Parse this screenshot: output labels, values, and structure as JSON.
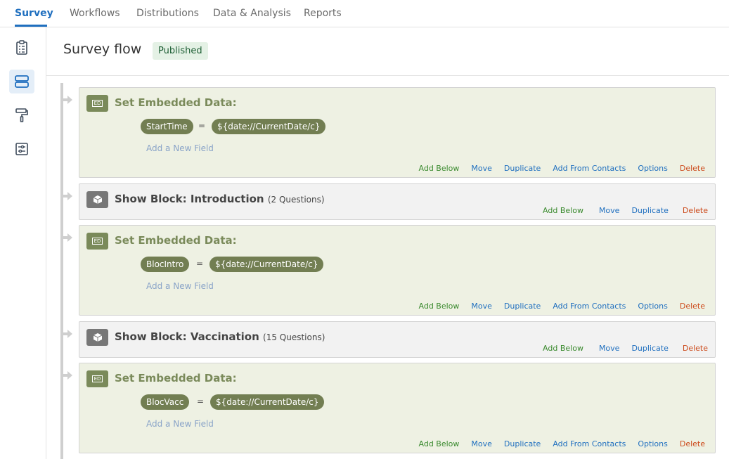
{
  "nav": {
    "tabs": [
      "Survey",
      "Workflows",
      "Distributions",
      "Data & Analysis",
      "Reports"
    ],
    "active": "Survey"
  },
  "sidebar": {
    "items": [
      {
        "icon": "clipboard-icon",
        "active": false
      },
      {
        "icon": "survey-flow-icon",
        "active": true
      },
      {
        "icon": "paint-roller-icon",
        "active": false
      },
      {
        "icon": "sliders-icon",
        "active": false
      }
    ]
  },
  "header": {
    "title": "Survey flow",
    "status": "Published"
  },
  "colors": {
    "accent": "#1f6fbf",
    "ed_bg": "#eef1e3",
    "ed_title": "#7a8a5a",
    "pill": "#727e52",
    "add_below": "#3a8a2e",
    "delete": "#cc4a1b"
  },
  "labels": {
    "add_below": "Add Below",
    "move": "Move",
    "duplicate": "Duplicate",
    "add_from_contacts": "Add From Contacts",
    "options": "Options",
    "delete": "Delete",
    "add_field": "Add a New Field",
    "ed_badge": "ED",
    "equals": "="
  },
  "flow": [
    {
      "type": "embedded",
      "title": "Set Embedded Data:",
      "field": "StartTime",
      "value": "${date://CurrentDate/c}"
    },
    {
      "type": "block",
      "title": "Show Block: Introduction",
      "count": "(2 Questions)"
    },
    {
      "type": "embedded",
      "title": "Set Embedded Data:",
      "field": "BlocIntro",
      "value": "${date://CurrentDate/c}"
    },
    {
      "type": "block",
      "title": "Show Block: Vaccination",
      "count": "(15 Questions)"
    },
    {
      "type": "embedded",
      "title": "Set Embedded Data:",
      "field": "BlocVacc",
      "value": "${date://CurrentDate/c}"
    }
  ]
}
